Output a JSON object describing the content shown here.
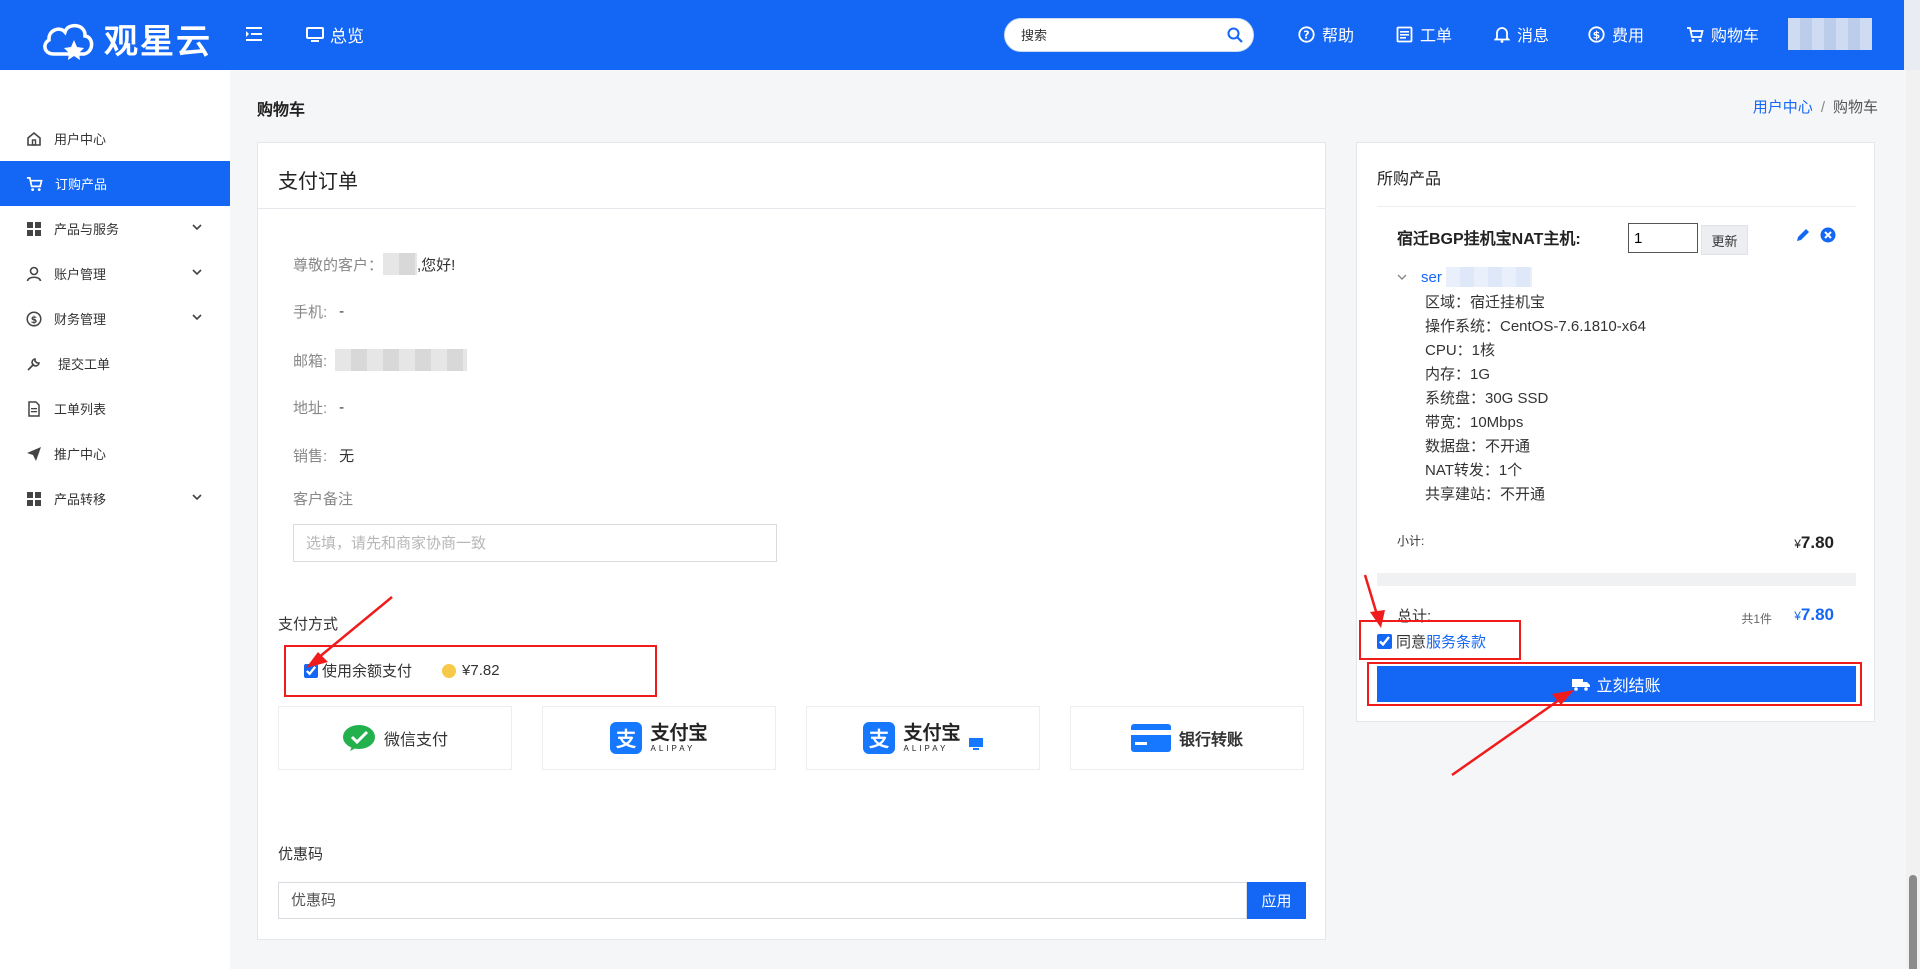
{
  "header": {
    "logo_text": "观星云",
    "overview": "总览",
    "search_placeholder": "搜索",
    "nav": [
      {
        "label": "帮助",
        "icon": "help-circle-icon"
      },
      {
        "label": "工单",
        "icon": "ticket-icon"
      },
      {
        "label": "消息",
        "icon": "bell-icon"
      },
      {
        "label": "费用",
        "icon": "dollar-icon"
      },
      {
        "label": "购物车",
        "icon": "cart-icon"
      }
    ]
  },
  "sidebar": {
    "items": [
      {
        "label": "用户中心",
        "icon": "home-icon",
        "active": false,
        "expandable": false
      },
      {
        "label": "订购产品",
        "icon": "cart-icon",
        "active": true,
        "expandable": false
      },
      {
        "label": "产品与服务",
        "icon": "grid-icon",
        "active": false,
        "expandable": true
      },
      {
        "label": "账户管理",
        "icon": "user-icon",
        "active": false,
        "expandable": true
      },
      {
        "label": "财务管理",
        "icon": "dollar-icon",
        "active": false,
        "expandable": true
      },
      {
        "label": "提交工单",
        "icon": "wrench-icon",
        "active": false,
        "expandable": false
      },
      {
        "label": "工单列表",
        "icon": "document-icon",
        "active": false,
        "expandable": false
      },
      {
        "label": "推广中心",
        "icon": "send-icon",
        "active": false,
        "expandable": false
      },
      {
        "label": "产品转移",
        "icon": "grid-icon",
        "active": false,
        "expandable": true
      }
    ]
  },
  "page": {
    "title": "购物车",
    "breadcrumb": {
      "link": "用户中心",
      "separator": "/",
      "current": "购物车"
    }
  },
  "order": {
    "title": "支付订单",
    "greeting_label": "尊敬的客户：",
    "greeting_suffix": ",您好!",
    "phone_label": "手机:",
    "phone_value": "-",
    "email_label": "邮箱:",
    "address_label": "地址:",
    "address_value": "-",
    "sales_label": "销售:",
    "sales_value": "无",
    "remark_label": "客户备注",
    "remark_placeholder": "选填，请先和商家协商一致",
    "payment_label": "支付方式",
    "balance_label": "使用余额支付",
    "balance_checked": true,
    "balance_value": "¥7.82",
    "payment_options": [
      {
        "label": "微信支付",
        "icon": "wechat-icon"
      },
      {
        "label": "支付宝",
        "sub": "ALIPAY",
        "icon": "alipay-icon"
      },
      {
        "label": "支付宝",
        "sub": "ALIPAY",
        "icon": "alipay-pc-icon"
      },
      {
        "label": "银行转账",
        "icon": "bank-card-icon"
      }
    ],
    "coupon_label": "优惠码",
    "coupon_placeholder": "优惠码",
    "apply_label": "应用"
  },
  "cart": {
    "title": "所购产品",
    "product_name": "宿迁BGP挂机宝NAT主机:",
    "quantity": "1",
    "update_label": "更新",
    "host_prefix": "ser",
    "specs": [
      "区域：宿迁挂机宝",
      "操作系统：CentOS-7.6.1810-x64",
      "CPU：1核",
      "内存：1G",
      "系统盘：30G SSD",
      "带宽：10Mbps",
      "数据盘：不开通",
      "NAT转发：1个",
      "共享建站：不开通"
    ],
    "subtotal_label": "小计:",
    "subtotal_currency": "¥",
    "subtotal_value": "7.80",
    "total_label": "总计:",
    "total_count": "共1件",
    "total_currency": "¥",
    "total_value": "7.80",
    "agree_prefix": "同意",
    "agree_link": "服务条款",
    "agree_checked": true,
    "checkout_label": "立刻结账"
  },
  "colors": {
    "primary": "#1466f5",
    "annotation": "#f01b1b"
  }
}
